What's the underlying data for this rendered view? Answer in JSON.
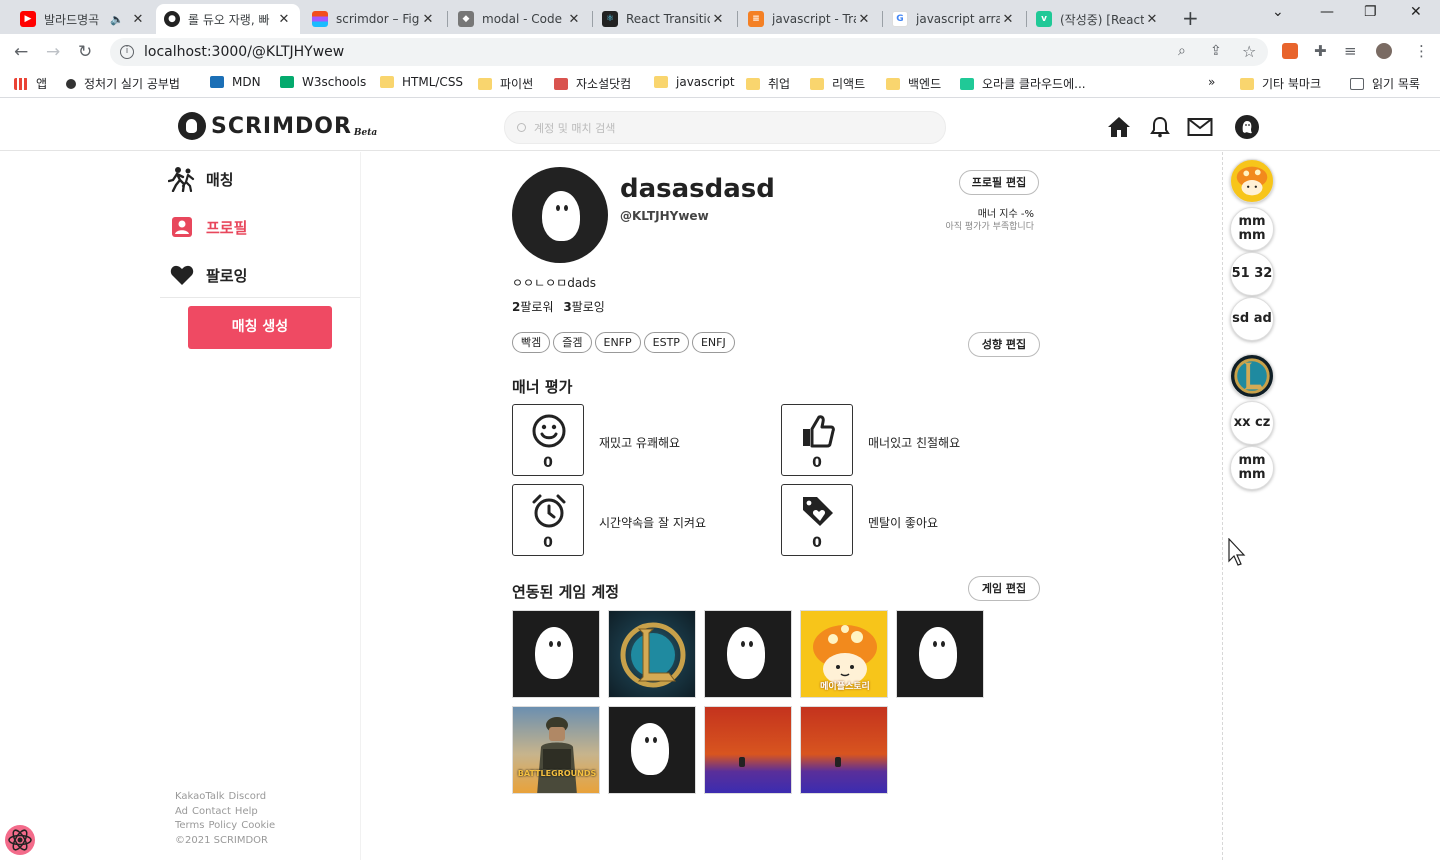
{
  "browser": {
    "tabs": [
      {
        "title": "발라드명곡",
        "color": "#ff0000"
      },
      {
        "title": "롤 듀오 자랭, 빠",
        "color": "#222222"
      },
      {
        "title": "scrimdor – Figma",
        "color": "#a259ff"
      },
      {
        "title": "modal - Code",
        "color": "#555555"
      },
      {
        "title": "React Transitio",
        "color": "#222222"
      },
      {
        "title": "javascript - Tra",
        "color": "#f48024"
      },
      {
        "title": "javascript array",
        "color": "#4285f4"
      },
      {
        "title": "(작성중) [React",
        "color": "#20c997"
      }
    ],
    "url": "localhost:3000/@KLTJHYwew",
    "bookmarks": [
      "앱",
      "정처기 실기 공부법",
      "MDN",
      "W3schools",
      "HTML/CSS",
      "파이썬",
      "자소설닷컴",
      "javascript",
      "취업",
      "리액트",
      "백엔드",
      "오라클 클라우드에...",
      "기타 북마크",
      "읽기 목록"
    ],
    "bookmarks_more": "»"
  },
  "site": {
    "logo": "SCRIMDOR",
    "beta": "Beta",
    "search_placeholder": "계정 및 매치 검색"
  },
  "nav": {
    "items": [
      {
        "label": "매칭"
      },
      {
        "label": "프로필"
      },
      {
        "label": "팔로잉"
      }
    ],
    "create_button": "매칭 생성",
    "active_color": "#e8475c"
  },
  "footer": {
    "row1": [
      "KakaoTalk",
      "Discord"
    ],
    "row2": [
      "Ad",
      "Contact",
      "Help"
    ],
    "row3": [
      "Terms",
      "Policy",
      "Cookie"
    ],
    "copyright": "©2021 SCRIMDOR"
  },
  "profile": {
    "name": "dasasdasd",
    "handle": "@KLTJHYwew",
    "edit_button": "프로필 편집",
    "manner_index": "매너 지수 -%",
    "manner_note": "아직 평가가 부족합니다",
    "bio": "ㅇㅇㄴㅇㅁdads",
    "followers_count": "2",
    "followers_label": "팔로워",
    "following_count": "3",
    "following_label": "팔로잉",
    "tags": [
      "빡겜",
      "즐겜",
      "ENFP",
      "ESTP",
      "ENFJ"
    ],
    "tags_edit_button": "성향 편집"
  },
  "manner": {
    "title": "매너 평가",
    "cards": [
      {
        "icon": "smile-icon",
        "count": "0",
        "label": "재밌고 유쾌해요"
      },
      {
        "icon": "thumbs-up-icon",
        "count": "0",
        "label": "매너있고 친절해요"
      },
      {
        "icon": "alarm-clock-icon",
        "count": "0",
        "label": "시간약속을 잘 지켜요"
      },
      {
        "icon": "heart-tag-icon",
        "count": "0",
        "label": "멘탈이 좋아요"
      }
    ]
  },
  "games": {
    "title": "연동된 게임 계정",
    "edit_button": "게임 편집",
    "tiles": [
      "ghost",
      "lol",
      "ghost",
      "maplestory",
      "ghost",
      "battlegrounds",
      "ghost",
      "sunset",
      "sunset"
    ],
    "maple_caption": "메이플스토리",
    "pubg_caption": "BATTLEGROUNDS"
  },
  "rightbar": [
    {
      "type": "image",
      "name": "maple-avatar"
    },
    {
      "type": "text",
      "text": "mm mm"
    },
    {
      "type": "text",
      "text": "51 32"
    },
    {
      "type": "text",
      "text": "sd ad"
    },
    {
      "type": "image",
      "name": "lol-avatar"
    },
    {
      "type": "text",
      "text": "xx cz"
    },
    {
      "type": "text",
      "text": "mm mm"
    }
  ]
}
